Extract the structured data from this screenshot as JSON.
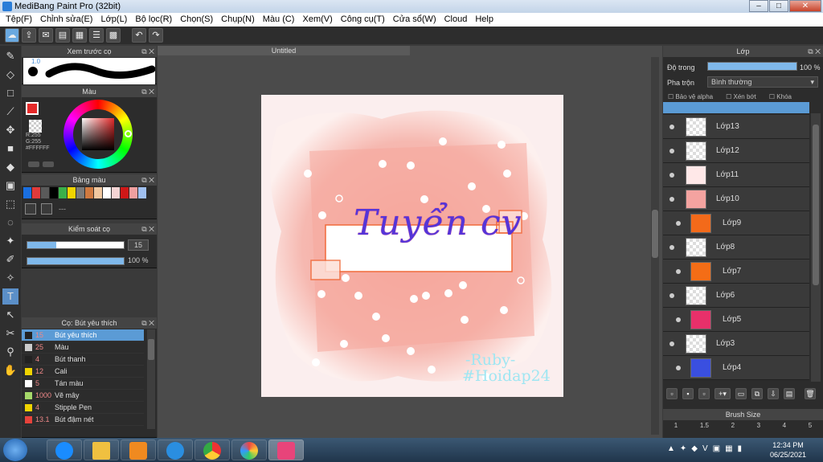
{
  "window": {
    "title": "MediBang Paint Pro (32bit)"
  },
  "menu": [
    "Tệp(F)",
    "Chỉnh sửa(E)",
    "Lớp(L)",
    "Bộ lọc(R)",
    "Chọn(S)",
    "Chụp(N)",
    "Màu (C)",
    "Xem(V)",
    "Công cụ(T)",
    "Cửa sổ(W)",
    "Cloud",
    "Help"
  ],
  "panels": {
    "brush_preview": {
      "title": "Xem trước cọ",
      "size": "1.0"
    },
    "color": {
      "title": "Màu",
      "r": "R:255",
      "g": "G:255",
      "hex": "#FFFFFF"
    },
    "palette": {
      "title": "Bảng màu",
      "name": "---"
    },
    "brush_control": {
      "title": "Kiểm soát cọ",
      "size": "15",
      "opacity": "100 %"
    },
    "brushes": {
      "title": "Cọ: Bút yêu thích",
      "items": [
        {
          "size": "15",
          "name": "Bút yêu thích",
          "color": "#222222",
          "selected": true
        },
        {
          "size": "25",
          "name": "Màu",
          "color": "#cccccc"
        },
        {
          "size": "4",
          "name": "Bút thanh",
          "color": "#222222"
        },
        {
          "size": "12",
          "name": "Cali",
          "color": "#f1d400"
        },
        {
          "size": "5",
          "name": "Tán màu",
          "color": "#ffffff"
        },
        {
          "size": "1000",
          "name": "Vẽ mây",
          "color": "#a6d96a"
        },
        {
          "size": "4",
          "name": "Stipple Pen",
          "color": "#f1d400"
        },
        {
          "size": "13.1",
          "name": "Bút đậm nét",
          "color": "#e8433b"
        }
      ]
    }
  },
  "document": {
    "tab": "Untitled"
  },
  "artwork": {
    "title_text": "Tuyển cv",
    "sign1": "-Ruby-",
    "sign2": "#Hoidap24"
  },
  "layers_panel": {
    "title": "Lớp",
    "opacity_label": "Độ trong",
    "opacity_value": "100 %",
    "blend_label": "Pha trộn",
    "blend_value": "Bình thường",
    "protect_alpha": "Bảo vệ alpha",
    "clip": "Xén bớt",
    "lock": "Khóa",
    "layers": [
      {
        "name": "Lớp13",
        "thumb": "#ffffff",
        "indent": false
      },
      {
        "name": "Lớp12",
        "thumb": "#ffffff",
        "indent": false
      },
      {
        "name": "Lớp11",
        "thumb": "#ffe8e8",
        "indent": false
      },
      {
        "name": "Lớp10",
        "thumb": "#f4a3a0",
        "indent": false
      },
      {
        "name": "Lớp9",
        "thumb": "#f36a1a",
        "indent": true
      },
      {
        "name": "Lớp8",
        "thumb": "#ffffff",
        "indent": false
      },
      {
        "name": "Lớp7",
        "thumb": "#f46d16",
        "indent": true
      },
      {
        "name": "Lớp6",
        "thumb": "#ffffff",
        "indent": false
      },
      {
        "name": "Lớp5",
        "thumb": "#e8306a",
        "indent": true
      },
      {
        "name": "Lớp3",
        "thumb": "#ffffff",
        "indent": false
      },
      {
        "name": "Lớp4",
        "thumb": "#3a4fe0",
        "indent": true
      }
    ]
  },
  "brush_size_panel": {
    "title": "Brush Size",
    "sizes": [
      "1",
      "1.5",
      "2",
      "3",
      "4",
      "5"
    ]
  },
  "taskbar": {
    "time": "12:34 PM",
    "date": "06/25/2021"
  },
  "colors": {
    "accent": "#5b9bd5",
    "panel": "#2c2c2c"
  }
}
